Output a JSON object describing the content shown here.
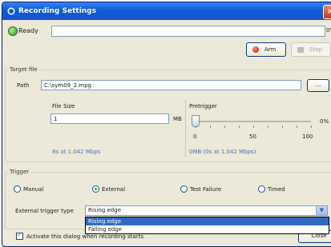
{
  "window": {
    "title": "Recording Settings",
    "close_label": "×"
  },
  "status": {
    "text": "Ready",
    "progress_label": "0%"
  },
  "toolbar": {
    "arm_label": "Arm",
    "stop_label": "Stop"
  },
  "target_file": {
    "group_title": "Target file",
    "path_label": "Path",
    "path_value": "C:\\sym09_2.mpg",
    "browse_label": "..."
  },
  "file_size": {
    "label": "File Size",
    "value": "1",
    "unit": "MB",
    "info": "8s at 1.042 Mbps"
  },
  "pretrigger": {
    "label": "Pretrigger",
    "value_percent": 0,
    "percent_label": "0%",
    "scale_min": "0",
    "scale_mid": "50",
    "scale_max": "100",
    "info": "0MB (0s at 1.042 Mbps)"
  },
  "trigger": {
    "group_title": "Trigger",
    "options": [
      {
        "label": "Manual",
        "selected": false
      },
      {
        "label": "External",
        "selected": true
      },
      {
        "label": "Test Failure",
        "selected": false
      },
      {
        "label": "Timed",
        "selected": false
      }
    ],
    "type_label": "External trigger type",
    "type_value": "Rising edge",
    "type_options": [
      "Rising edge",
      "Falling edge"
    ]
  },
  "footer": {
    "activate_label": "Activate this dialog when recording starts",
    "activate_checked": true,
    "close_label": "Close"
  },
  "colors": {
    "titlebar": "#0c5bd8",
    "ready": "#1f9b17",
    "arm": "#c1120c",
    "selection": "#316ac5"
  }
}
